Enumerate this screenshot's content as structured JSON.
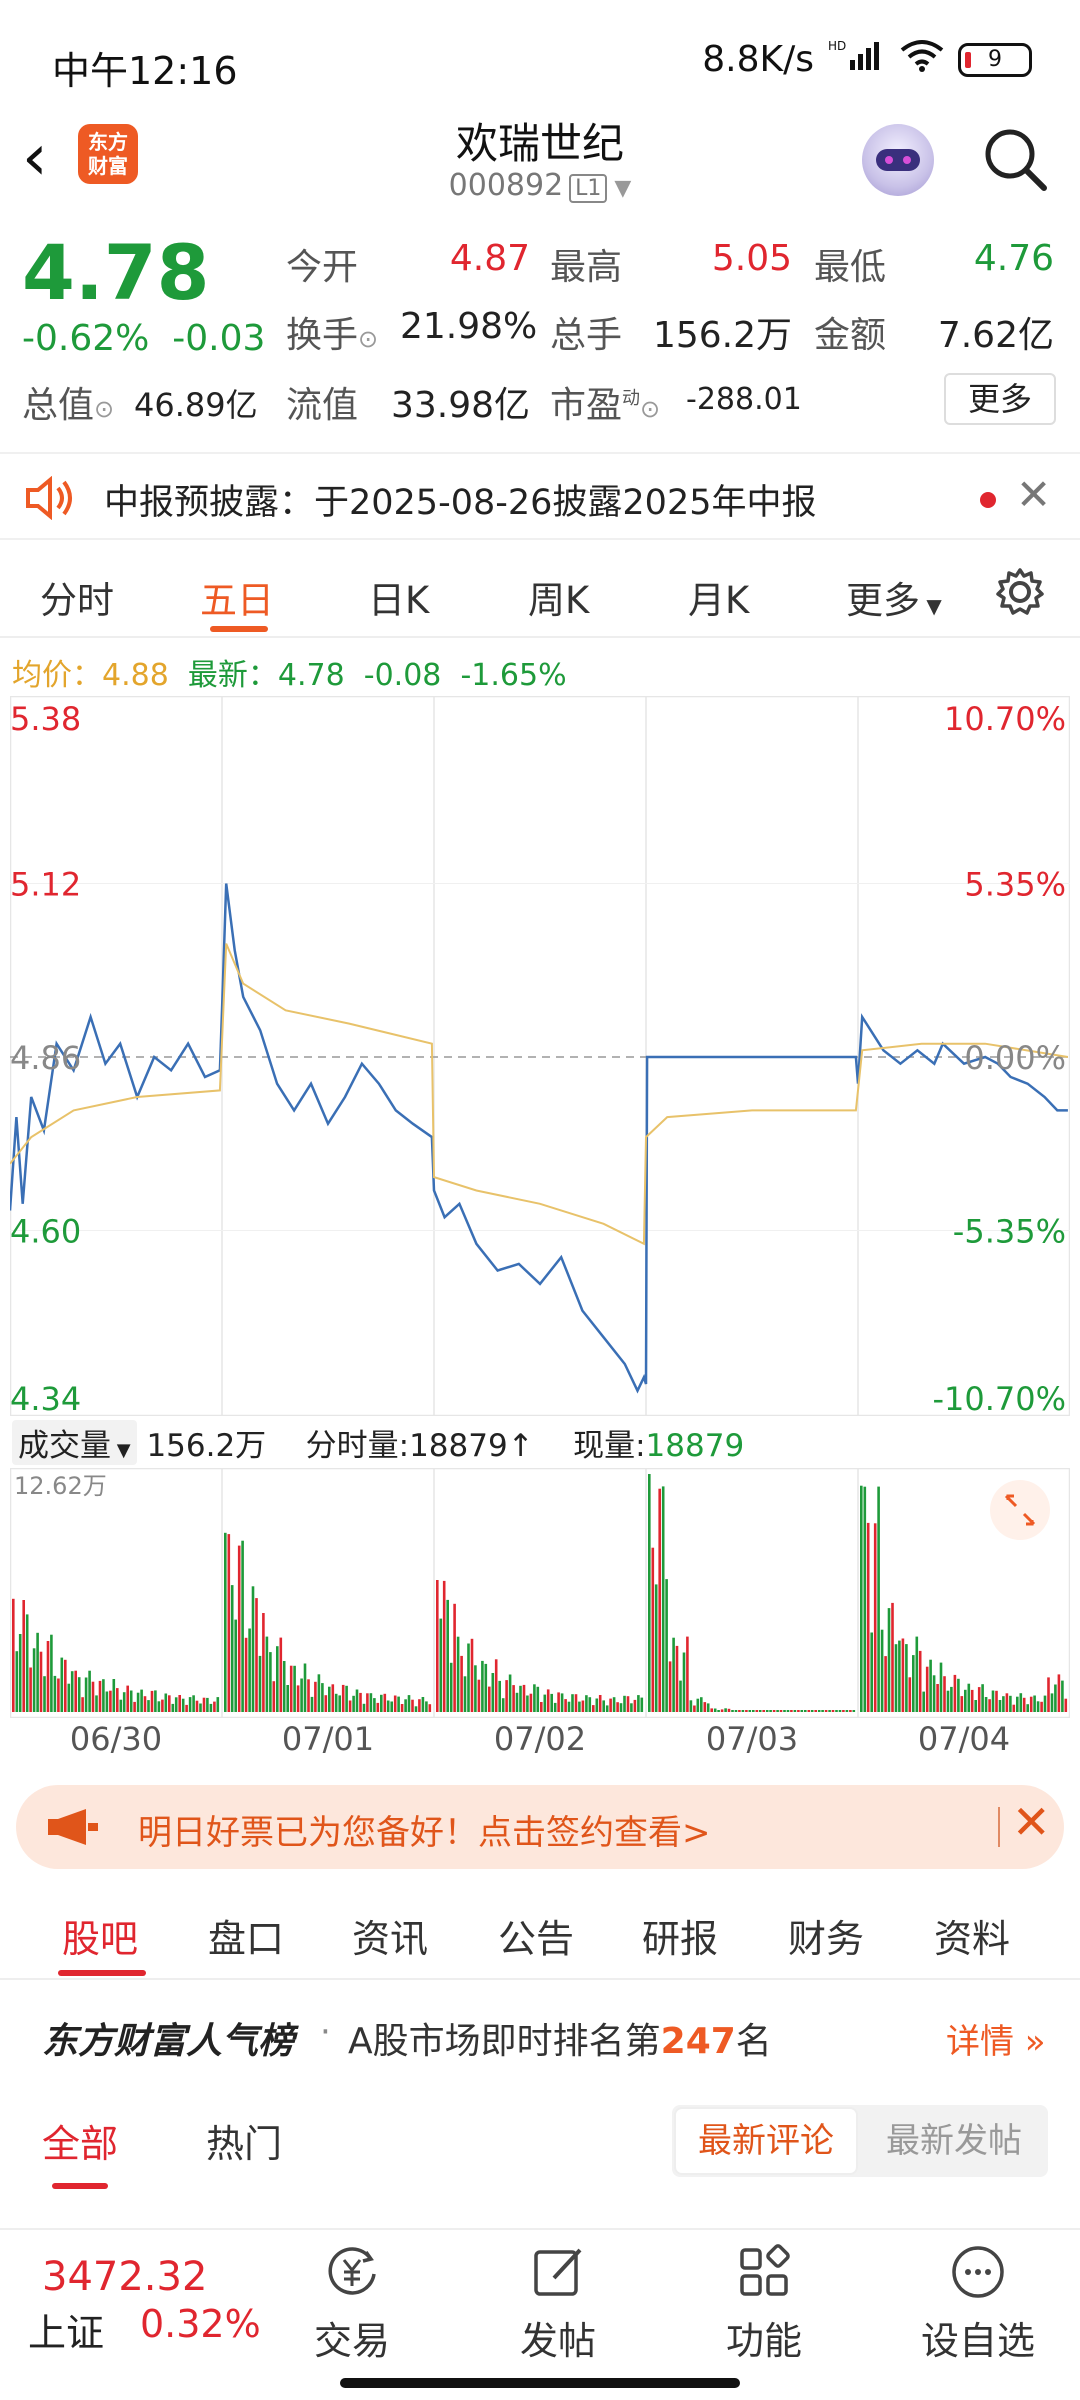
{
  "status_bar": {
    "time": "中午12:16",
    "net_speed": "8.8K/s",
    "net_tag": "HD",
    "battery": "9"
  },
  "header": {
    "stock_name": "欢瑞世纪",
    "stock_code": "000892",
    "level": "L1",
    "logo_text": "东方财富"
  },
  "quote": {
    "price": "4.78",
    "change_pct": "-0.62%",
    "change_amt": "-0.03",
    "open_label": "今开",
    "open": "4.87",
    "high_label": "最高",
    "high": "5.05",
    "low_label": "最低",
    "low": "4.76",
    "turnover_label": "换手",
    "turnover": "21.98%",
    "volume_label": "总手",
    "volume": "156.2万",
    "amount_label": "金额",
    "amount": "7.62亿",
    "mktcap_label": "总值",
    "mktcap": "46.89亿",
    "float_label": "流值",
    "float": "33.98亿",
    "pe_label": "市盈",
    "pe_sup": "动",
    "pe": "-288.01",
    "more_label": "更多"
  },
  "notice": {
    "text": "中报预披露：于2025-08-26披露2025年中报"
  },
  "chart_tabs": [
    "分时",
    "五日",
    "日K",
    "周K",
    "月K",
    "更多"
  ],
  "chart_tab_active": "五日",
  "avg_line": {
    "avg_label": "均价：",
    "avg": "4.88",
    "latest_label": "最新：",
    "latest": "4.78",
    "chg": "-0.08",
    "pct": "-1.65%"
  },
  "volume_header": {
    "selector": "成交量",
    "total": "156.2万",
    "tick_label": "分时量:",
    "tick": "18879",
    "arrow": "↑",
    "now_label": "现量:",
    "now": "18879"
  },
  "vol_max_label": "12.62万",
  "chart_data": {
    "type": "line",
    "title": "",
    "ylim": [
      4.34,
      5.38
    ],
    "y_left_ticks": [
      "5.38",
      "5.12",
      "4.86",
      "4.60",
      "4.34"
    ],
    "y_right_ticks": [
      "10.70%",
      "5.35%",
      "0.00%",
      "-5.35%",
      "-10.70%"
    ],
    "prev_close": 4.86,
    "days": [
      "06/30",
      "07/01",
      "07/02",
      "07/03",
      "07/04"
    ],
    "series": [
      {
        "name": "价格",
        "color": "#3a6fb5",
        "points": [
          [
            0,
            4.63
          ],
          [
            0.03,
            4.77
          ],
          [
            0.06,
            4.64
          ],
          [
            0.1,
            4.8
          ],
          [
            0.16,
            4.75
          ],
          [
            0.22,
            4.88
          ],
          [
            0.3,
            4.84
          ],
          [
            0.38,
            4.92
          ],
          [
            0.45,
            4.85
          ],
          [
            0.52,
            4.88
          ],
          [
            0.6,
            4.8
          ],
          [
            0.68,
            4.86
          ],
          [
            0.76,
            4.84
          ],
          [
            0.84,
            4.88
          ],
          [
            0.92,
            4.83
          ],
          [
            0.99,
            4.84
          ],
          [
            1.0,
            4.93
          ],
          [
            1.02,
            5.12
          ],
          [
            1.06,
            5.02
          ],
          [
            1.1,
            4.95
          ],
          [
            1.18,
            4.9
          ],
          [
            1.26,
            4.82
          ],
          [
            1.34,
            4.78
          ],
          [
            1.42,
            4.82
          ],
          [
            1.5,
            4.76
          ],
          [
            1.58,
            4.8
          ],
          [
            1.66,
            4.85
          ],
          [
            1.74,
            4.82
          ],
          [
            1.82,
            4.78
          ],
          [
            1.9,
            4.76
          ],
          [
            1.99,
            4.74
          ],
          [
            2.0,
            4.66
          ],
          [
            2.05,
            4.62
          ],
          [
            2.12,
            4.64
          ],
          [
            2.2,
            4.58
          ],
          [
            2.3,
            4.54
          ],
          [
            2.4,
            4.55
          ],
          [
            2.5,
            4.52
          ],
          [
            2.6,
            4.56
          ],
          [
            2.7,
            4.48
          ],
          [
            2.8,
            4.44
          ],
          [
            2.9,
            4.4
          ],
          [
            2.96,
            4.36
          ],
          [
            2.99,
            4.38
          ],
          [
            3.0,
            4.37
          ],
          [
            3.005,
            4.86
          ],
          [
            3.99,
            4.86
          ],
          [
            4.0,
            4.82
          ],
          [
            4.02,
            4.92
          ],
          [
            4.06,
            4.9
          ],
          [
            4.12,
            4.87
          ],
          [
            4.2,
            4.85
          ],
          [
            4.28,
            4.87
          ],
          [
            4.36,
            4.85
          ],
          [
            4.4,
            4.88
          ],
          [
            4.5,
            4.85
          ],
          [
            4.6,
            4.86
          ],
          [
            4.66,
            4.85
          ],
          [
            4.72,
            4.83
          ],
          [
            4.8,
            4.82
          ],
          [
            4.88,
            4.8
          ],
          [
            4.94,
            4.78
          ],
          [
            4.99,
            4.78
          ]
        ]
      },
      {
        "name": "均价",
        "color": "#e8c26a",
        "points": [
          [
            0,
            4.7
          ],
          [
            0.1,
            4.74
          ],
          [
            0.3,
            4.78
          ],
          [
            0.6,
            4.8
          ],
          [
            0.99,
            4.81
          ],
          [
            1.02,
            5.03
          ],
          [
            1.1,
            4.97
          ],
          [
            1.3,
            4.93
          ],
          [
            1.6,
            4.91
          ],
          [
            1.99,
            4.88
          ],
          [
            2.0,
            4.68
          ],
          [
            2.2,
            4.66
          ],
          [
            2.5,
            4.64
          ],
          [
            2.8,
            4.61
          ],
          [
            2.99,
            4.58
          ],
          [
            3.0,
            4.74
          ],
          [
            3.1,
            4.77
          ],
          [
            3.5,
            4.78
          ],
          [
            3.99,
            4.78
          ],
          [
            4.02,
            4.87
          ],
          [
            4.3,
            4.88
          ],
          [
            4.6,
            4.88
          ],
          [
            4.99,
            4.86
          ]
        ]
      }
    ],
    "volume": {
      "max": 126200,
      "units": "股",
      "day_volumes": [
        [
          60000,
          42000,
          30000,
          22000,
          18000,
          14000,
          12000,
          10000,
          9000,
          8000
        ],
        [
          95000,
          68000,
          40000,
          26000,
          20000,
          15000,
          12000,
          10000,
          9000,
          8000
        ],
        [
          70000,
          40000,
          28000,
          20000,
          15000,
          12000,
          10000,
          9000,
          8000,
          9000
        ],
        [
          126200,
          40000,
          8000,
          2000,
          1000,
          800,
          600,
          500,
          500,
          800
        ],
        [
          120000,
          60000,
          40000,
          28000,
          20000,
          15000,
          12000,
          10000,
          9000,
          20000
        ]
      ]
    }
  },
  "banner": {
    "text": "明日好票已为您备好！点击签约查看>"
  },
  "bottom_tabs": [
    "股吧",
    "盘口",
    "资讯",
    "公告",
    "研报",
    "财务",
    "资料"
  ],
  "bottom_tab_active": "股吧",
  "rank": {
    "brand": "东方财富人气榜",
    "sep": "·",
    "text_before": "A股市场即时排名第",
    "rank": "247",
    "text_after": "名",
    "detail": "详情"
  },
  "feed_tabs": [
    "全部",
    "热门"
  ],
  "feed_seg": [
    "最新评论",
    "最新发帖"
  ],
  "index": {
    "value": "3472.32",
    "name": "上证",
    "pct": "0.32%"
  },
  "nav": [
    "交易",
    "发帖",
    "功能",
    "设自选"
  ]
}
